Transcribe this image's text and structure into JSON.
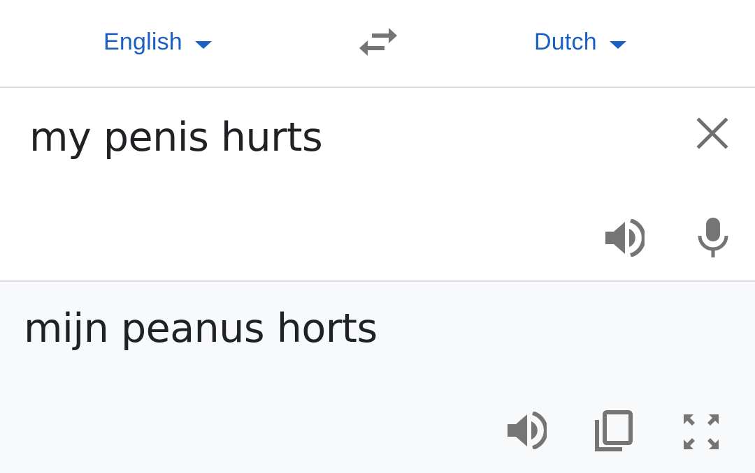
{
  "languages": {
    "source": "English",
    "target": "Dutch"
  },
  "input": {
    "text": "my penis hurts"
  },
  "output": {
    "text": "mijn peanus horts"
  },
  "icons": {
    "swap": "swap-arrows-icon",
    "clear": "close-icon",
    "source_speaker": "speaker-icon",
    "mic": "microphone-icon",
    "target_speaker": "speaker-icon",
    "copy": "copy-icon",
    "fullscreen": "fullscreen-icon"
  },
  "colors": {
    "accent": "#1a5fc4",
    "icon": "#757575",
    "text": "#202124",
    "translation_bg": "#f8f9fa",
    "divider": "#dadce0"
  }
}
